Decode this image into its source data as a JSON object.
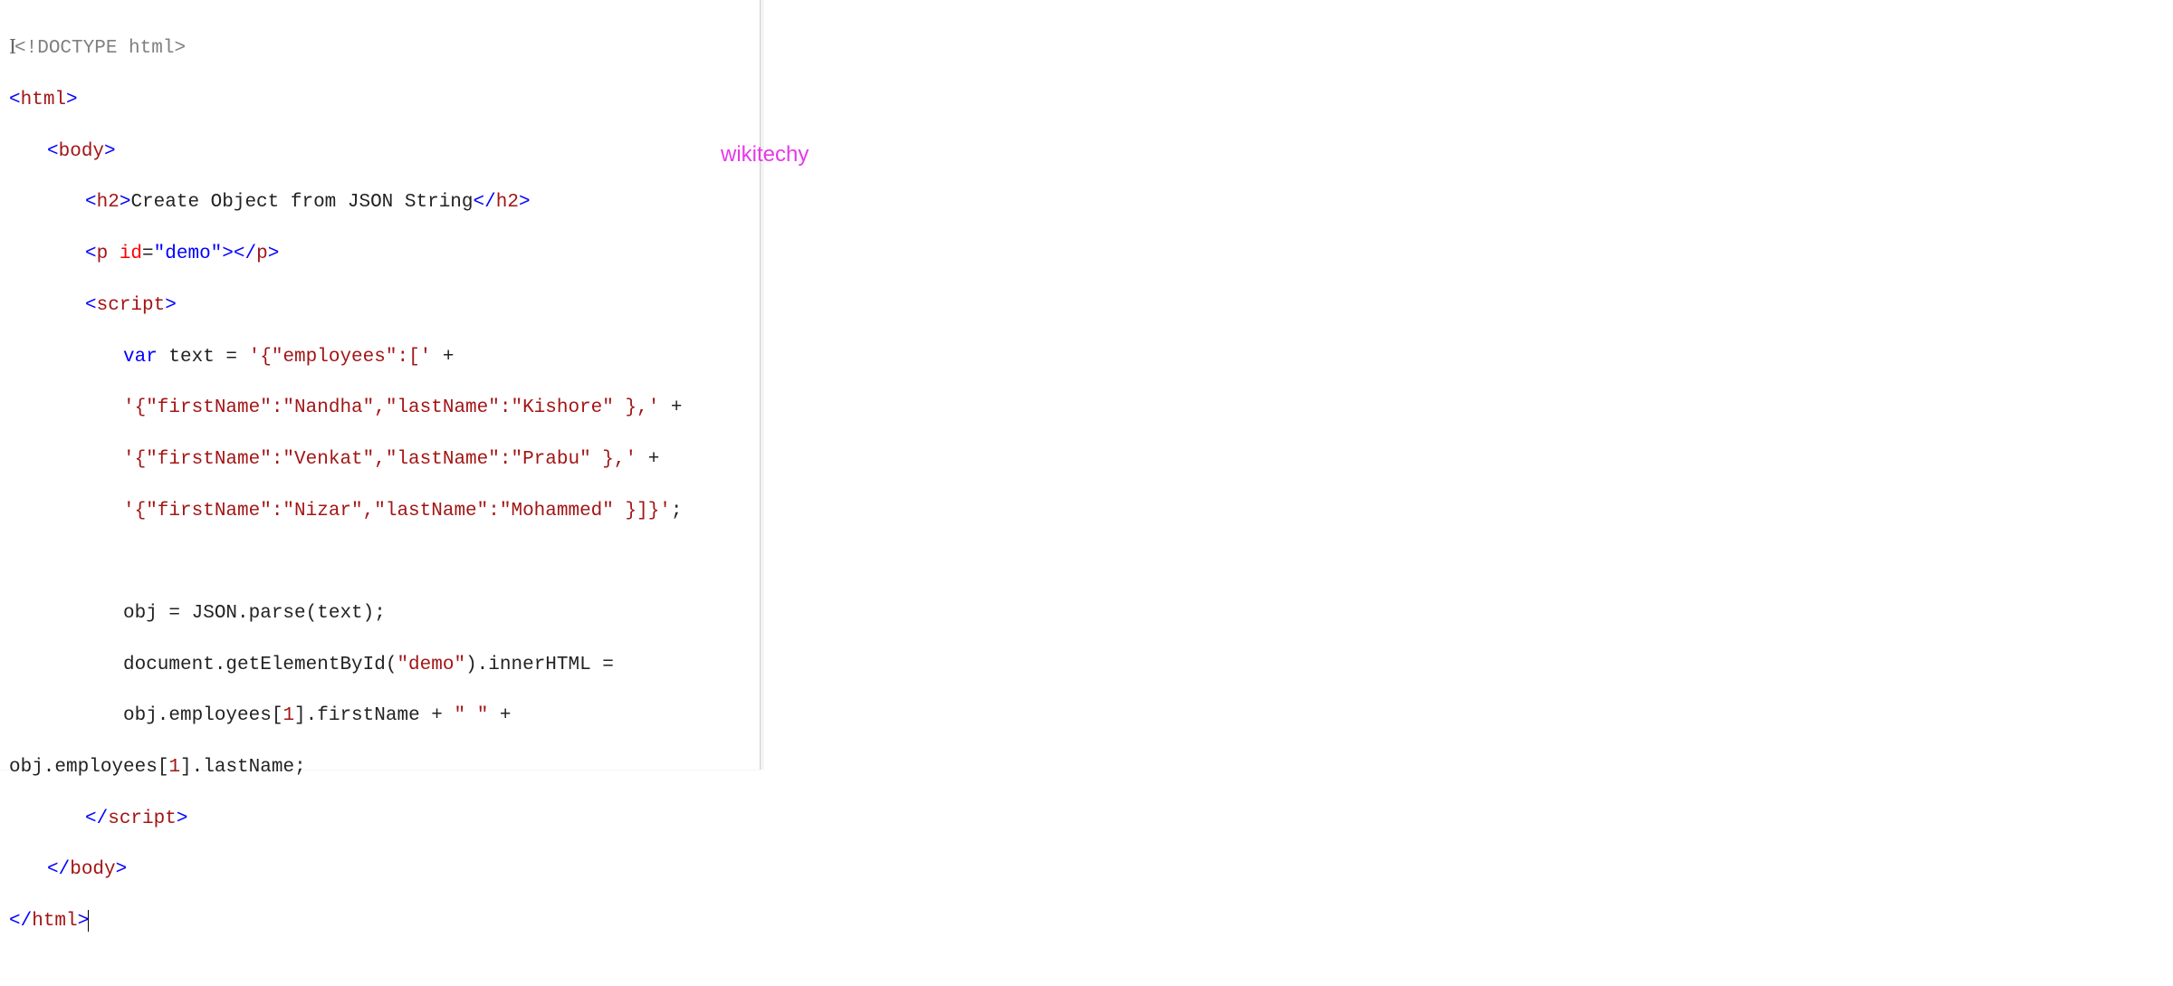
{
  "watermark": "wikitechy",
  "code": {
    "doctype_open": "<!",
    "doctype_text": "DOCTYPE",
    "doctype_rest": " html",
    "doctype_close": ">",
    "html_open_lt": "<",
    "html_tag": "html",
    "html_gt": ">",
    "body_open_lt": "<",
    "body_tag": "body",
    "body_gt": ">",
    "h2_open_lt": "<",
    "h2_tag": "h2",
    "h2_gt": ">",
    "h2_text": "Create Object from JSON String",
    "h2_close_lt": "</",
    "h2_close_gt": ">",
    "p_open_lt": "<",
    "p_tag": "p",
    "p_sp": " ",
    "p_attr": "id",
    "p_eq": "=",
    "p_val": "\"demo\"",
    "p_gt": ">",
    "p_close_lt": "</",
    "p_close_gt": ">",
    "script_open_lt": "<",
    "script_tag": "script",
    "script_gt": ">",
    "var_kw": "var",
    "var_rest": " text = ",
    "str1": "'{\"employees\":['",
    "plus": " +",
    "str2": "'{\"firstName\":\"Nandha\",\"lastName\":\"Kishore\" },'",
    "str3": "'{\"firstName\":\"Venkat\",\"lastName\":\"Prabu\" },'",
    "str4": "'{\"firstName\":\"Nizar\",\"lastName\":\"Mohammed\" }]}'",
    "semi": ";",
    "parse_line": "obj = JSON.parse(text);",
    "doc_line_a": "document.getElementById(",
    "doc_demo": "\"demo\"",
    "doc_line_b": ").innerHTML =",
    "emp_a": "obj.employees[",
    "one": "1",
    "emp_b": "].firstName + ",
    "space_str": "\" \"",
    "emp_c": " +",
    "last_a": "obj.employees[",
    "last_b": "].lastName;",
    "script_close_lt": "</",
    "script_close_gt": ">",
    "body_close_lt": "</",
    "body_close_gt": ">",
    "html_close_lt": "</",
    "html_close_gt": ">"
  }
}
